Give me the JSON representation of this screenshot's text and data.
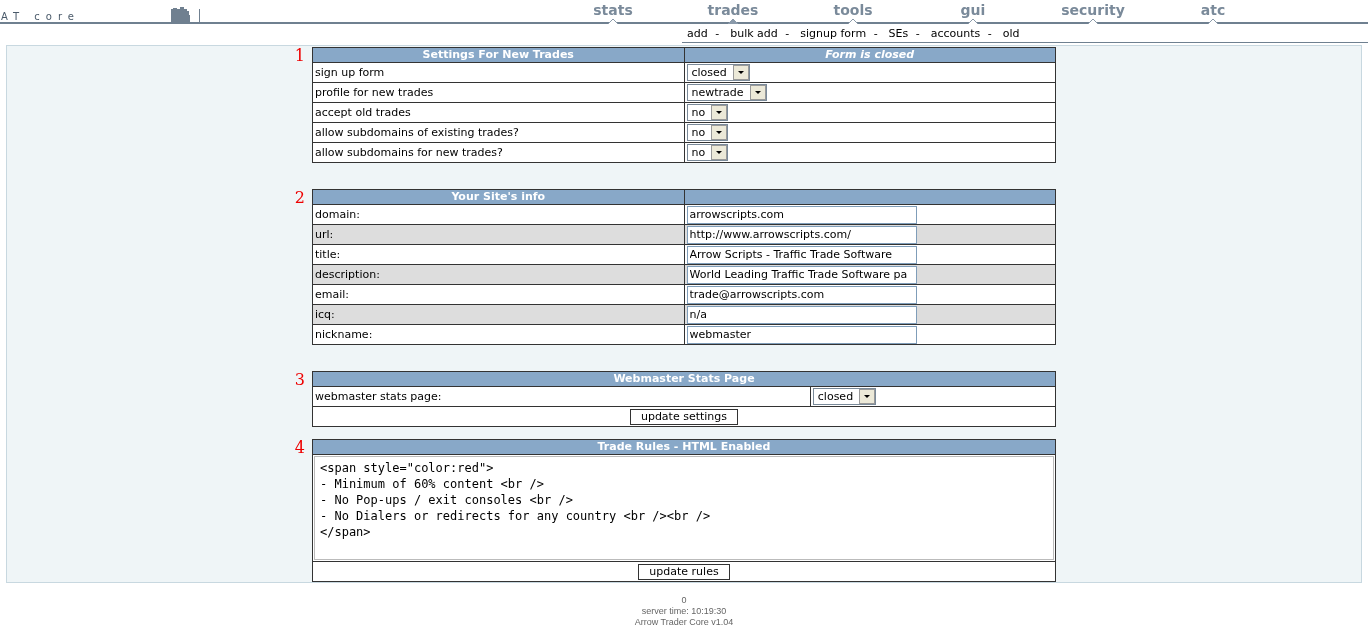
{
  "header": {
    "logo": "AT core",
    "nav": [
      {
        "label": "stats",
        "selected": false
      },
      {
        "label": "trades",
        "selected": true
      },
      {
        "label": "tools",
        "selected": false
      },
      {
        "label": "gui",
        "selected": false
      },
      {
        "label": "security",
        "selected": false
      },
      {
        "label": "atc",
        "selected": false
      }
    ],
    "subnav": [
      "add",
      "bulk add",
      "signup form",
      "SEs",
      "accounts",
      "old"
    ],
    "subnav_separator": "-"
  },
  "sections": [
    {
      "number": "1",
      "kind": "settings",
      "title": "Settings For New Trades",
      "status": "Form is closed",
      "rows": [
        {
          "label": "sign up form",
          "value": "closed"
        },
        {
          "label": "profile for new trades",
          "value": "newtrade"
        },
        {
          "label": "accept old trades",
          "value": "no"
        },
        {
          "label": "allow subdomains of existing trades?",
          "value": "no"
        },
        {
          "label": "allow subdomains for new trades?",
          "value": "no"
        }
      ]
    },
    {
      "number": "2",
      "kind": "info",
      "title": "Your Site's info",
      "rows": [
        {
          "label": "domain:",
          "value": "arrowscripts.com"
        },
        {
          "label": "url:",
          "value": "http://www.arrowscripts.com/"
        },
        {
          "label": "title:",
          "value": "Arrow Scripts - Traffic Trade Software"
        },
        {
          "label": "description:",
          "value": "World Leading Traffic Trade Software pa"
        },
        {
          "label": "email:",
          "value": "trade@arrowscripts.com"
        },
        {
          "label": "icq:",
          "value": "n/a"
        },
        {
          "label": "nickname:",
          "value": "webmaster"
        }
      ]
    },
    {
      "number": "3",
      "kind": "stats",
      "title": "Webmaster Stats Page",
      "rows": [
        {
          "label": "webmaster stats page:",
          "value": "closed"
        }
      ],
      "button": "update settings"
    },
    {
      "number": "4",
      "kind": "rules",
      "title": "Trade Rules - HTML Enabled",
      "text": "<span style=\"color:red\">\n- Minimum of 60% content <br />\n- No Pop-ups / exit consoles <br />\n- No Dialers or redirects for any country <br /><br />\n</span>",
      "button": "update rules"
    }
  ],
  "footer": [
    "0",
    "server time: 10:19:30",
    "Arrow Trader Core v1.04"
  ]
}
